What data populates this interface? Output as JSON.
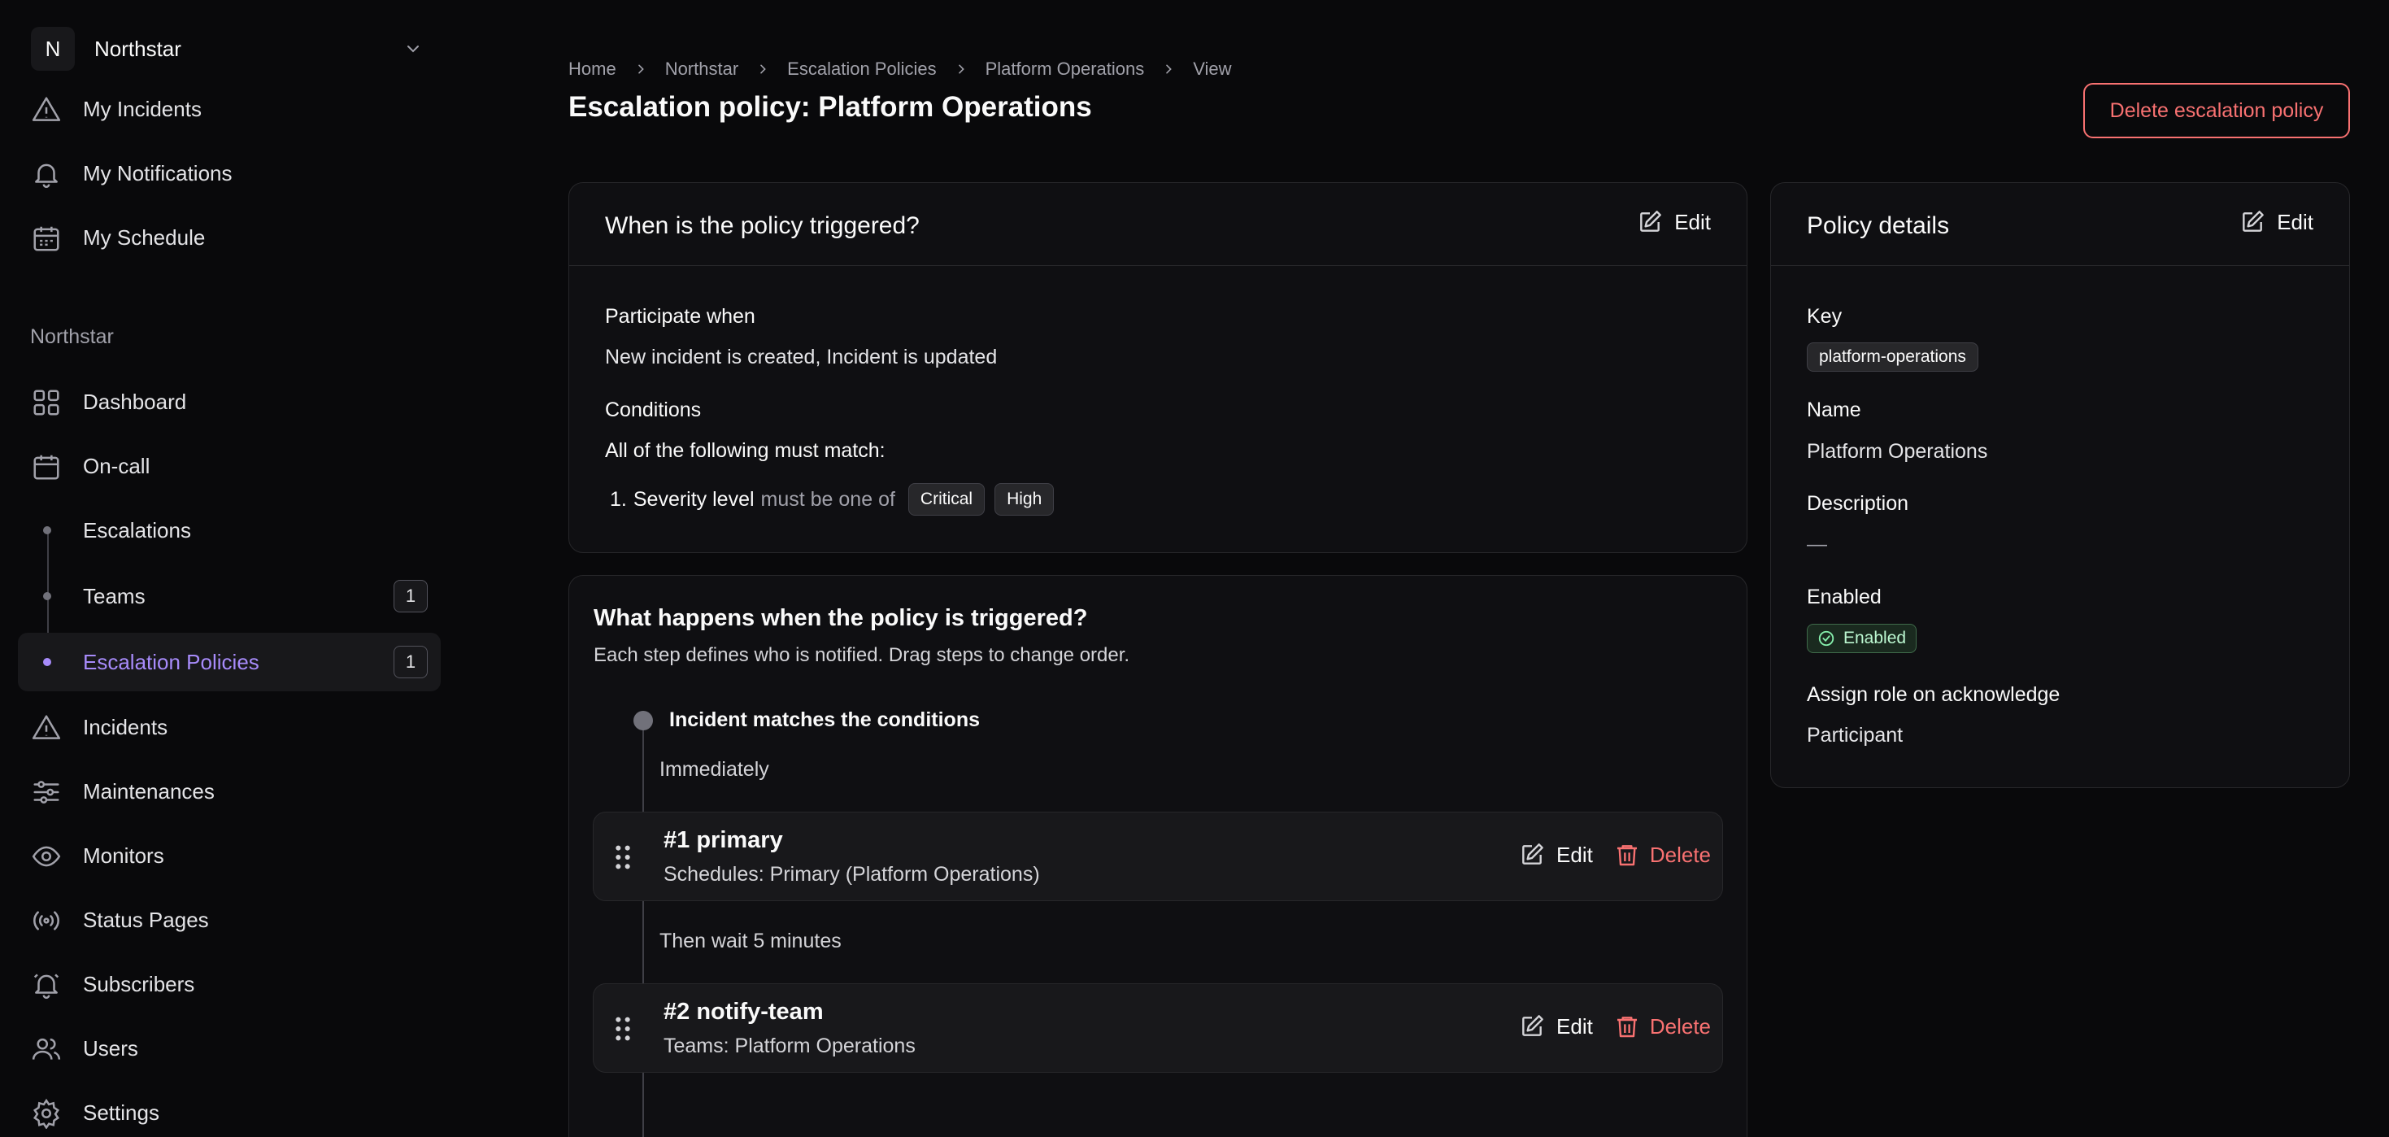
{
  "org": {
    "initial": "N",
    "name": "Northstar"
  },
  "nav_top": [
    {
      "label": "My Incidents",
      "icon": "alert-triangle-icon"
    },
    {
      "label": "My Notifications",
      "icon": "bell-icon"
    },
    {
      "label": "My Schedule",
      "icon": "calendar-icon"
    }
  ],
  "section_title": "Northstar",
  "nav_main": {
    "dashboard": "Dashboard",
    "oncall": "On-call",
    "escalations": "Escalations",
    "teams": "Teams",
    "teams_badge": "1",
    "escalation_policies": "Escalation Policies",
    "escalation_policies_badge": "1",
    "incidents": "Incidents",
    "maintenances": "Maintenances",
    "monitors": "Monitors",
    "status_pages": "Status Pages",
    "subscribers": "Subscribers",
    "users": "Users",
    "settings": "Settings"
  },
  "breadcrumb": [
    "Home",
    "Northstar",
    "Escalation Policies",
    "Platform Operations",
    "View"
  ],
  "page_title": "Escalation policy: Platform Operations",
  "delete_policy_label": "Delete escalation policy",
  "trigger_card": {
    "title": "When is the policy triggered?",
    "edit_label": "Edit",
    "participate_label": "Participate when",
    "participate_value": "New incident is created, Incident is updated",
    "conditions_label": "Conditions",
    "match_label": "All of the following must match:",
    "condition_index": "1.",
    "condition_field": "Severity level",
    "condition_operator": "must be one of",
    "condition_values": [
      "Critical",
      "High"
    ]
  },
  "steps_card": {
    "title": "What happens when the policy is triggered?",
    "subtitle": "Each step defines who is notified. Drag steps to change order.",
    "start_label": "Incident matches the conditions",
    "immediately": "Immediately",
    "wait_label": "Then wait 5 minutes",
    "steps": [
      {
        "title": "#1 primary",
        "subtitle": "Schedules: Primary (Platform Operations)",
        "edit": "Edit",
        "delete": "Delete"
      },
      {
        "title": "#2 notify-team",
        "subtitle": "Teams: Platform Operations",
        "edit": "Edit",
        "delete": "Delete"
      }
    ]
  },
  "details_card": {
    "title": "Policy details",
    "edit_label": "Edit",
    "key_label": "Key",
    "key_value": "platform-operations",
    "name_label": "Name",
    "name_value": "Platform Operations",
    "description_label": "Description",
    "description_value": "—",
    "enabled_label": "Enabled",
    "enabled_value": "Enabled",
    "role_label": "Assign role on acknowledge",
    "role_value": "Participant"
  },
  "colors": {
    "accent": "#a78bfa",
    "danger": "#f87171",
    "success": "#86efac",
    "background": "#09090b"
  }
}
